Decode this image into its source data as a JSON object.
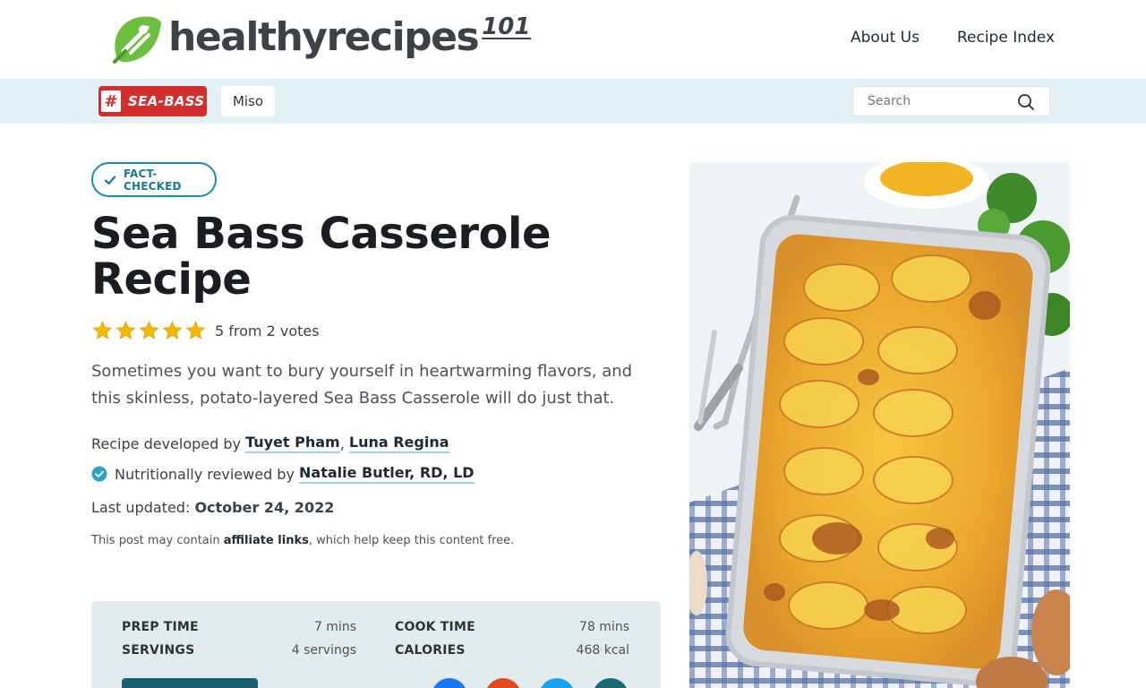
{
  "header": {
    "logo_text": "healthyrecipes",
    "logo_suffix": "101",
    "nav": [
      "About Us",
      "Recipe Index"
    ]
  },
  "tagbar": {
    "primary_tag": "SEA-BASS",
    "hash": "#",
    "secondary_tag": "Miso",
    "search_placeholder": "Search"
  },
  "article": {
    "badge": "FACT-CHECKED",
    "title": "Sea Bass Casserole Recipe",
    "rating_stars": 5,
    "rating_text": "5 from 2 votes",
    "description": "Sometimes you want to bury yourself in heartwarming flavors, and this skinless, potato-layered Sea Bass Casserole will do just that.",
    "byline_prefix": "Recipe developed by",
    "authors": [
      "Tuyet Pham",
      "Luna Regina"
    ],
    "reviewed_prefix": "Nutritionally reviewed by",
    "reviewer": "Natalie Butler, RD, LD",
    "updated_label": "Last updated:",
    "updated_date": "October 24, 2022",
    "affiliate_pre": "This post may contain",
    "affiliate_link": "affiliate links",
    "affiliate_post": ", which help keep this content free."
  },
  "infobox": {
    "prep_label": "PREP TIME",
    "prep_value": "7 mins",
    "servings_label": "SERVINGS",
    "servings_value": "4 servings",
    "cook_label": "COOK TIME",
    "cook_value": "78 mins",
    "calories_label": "CALORIES",
    "calories_value": "468 kcal"
  },
  "colors": {
    "accent": "#1a8ea8",
    "tag_red": "#d32f2f",
    "tagbar_bg": "#e2f1f4",
    "logo_green": "#6cbf3e"
  }
}
